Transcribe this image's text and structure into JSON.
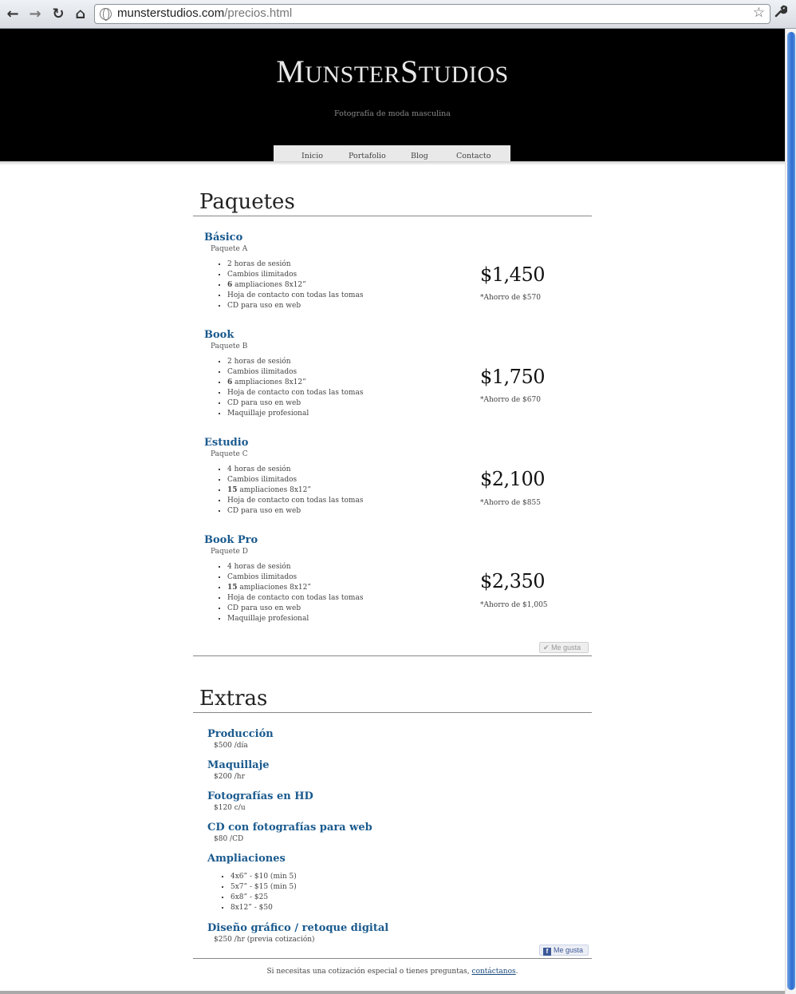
{
  "browser": {
    "back": "←",
    "forward": "→",
    "reload": "↻",
    "home": "⌂",
    "url_host": "munsterstudios.com",
    "url_path": "/precios.html",
    "star": "☆",
    "menu_icon": "wrench-icon"
  },
  "site": {
    "logo_text": "MunsterStudios",
    "tagline": "Fotografía de moda masculina",
    "menu": [
      "Inicio",
      "Portafolio",
      "Blog",
      "Contacto"
    ]
  },
  "paquetes": {
    "title": "Paquetes",
    "items": [
      {
        "name": "Básico",
        "sub": "Paquete A",
        "features": [
          "2 horas de sesión",
          "Cambios ilimitados",
          "6 ampliaciones 8x12”",
          "Hoja de contacto con todas las tomas",
          "CD para uso en web"
        ],
        "price": "$1,450",
        "saving": "*Ahorro de $570"
      },
      {
        "name": "Book",
        "sub": "Paquete B",
        "features": [
          "2 horas de sesión",
          "Cambios ilimitados",
          "6 ampliaciones 8x12”",
          "Hoja de contacto con todas las tomas",
          "CD para uso en web",
          "Maquillaje profesional"
        ],
        "price": "$1,750",
        "saving": "*Ahorro de $670"
      },
      {
        "name": "Estudio",
        "sub": "Paquete C",
        "features": [
          "4 horas de sesión",
          "Cambios ilimitados",
          "15 ampliaciones 8x12”",
          "Hoja de contacto con todas las tomas",
          "CD para uso en web"
        ],
        "price": "$2,100",
        "saving": "*Ahorro de $855"
      },
      {
        "name": "Book Pro",
        "sub": "Paquete D",
        "features": [
          "4 horas de sesión",
          "Cambios ilimitados",
          "15 ampliaciones 8x12”",
          "Hoja de contacto con todas las tomas",
          "CD para uso en web",
          "Maquillaje profesional"
        ],
        "price": "$2,350",
        "saving": "*Ahorro de $1,005"
      }
    ],
    "like": "Me gusta"
  },
  "extras": {
    "title": "Extras",
    "items": [
      {
        "name": "Producción",
        "price": "$500 /día"
      },
      {
        "name": "Maquillaje",
        "price": "$200 /hr"
      },
      {
        "name": "Fotografías en HD",
        "price": "$120 c/u"
      },
      {
        "name": "CD con fotografías para web",
        "price": "$80 /CD"
      },
      {
        "name": "Ampliaciones",
        "price": ""
      },
      {
        "name": "Diseño gráfico / retoque digital",
        "price": "$250 /hr (previa cotización)"
      }
    ],
    "ampliaciones": [
      "4x6” - $10 (min 5)",
      "5x7” - $15 (min 5)",
      "6x8” - $25",
      "8x12” - $50"
    ],
    "like": "Me gusta"
  },
  "footer": {
    "text": "Si necesitas una cotización especial o tienes preguntas, ",
    "link": "contáctanos",
    "end": "."
  }
}
